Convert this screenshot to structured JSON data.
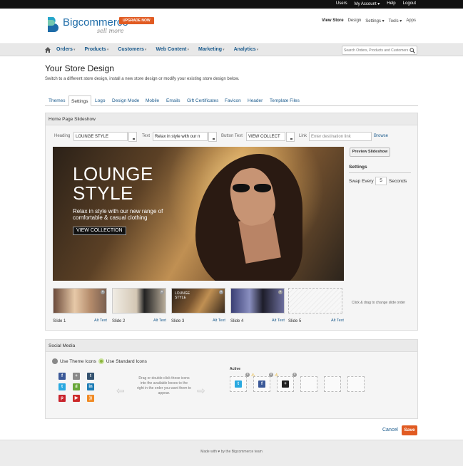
{
  "topbar": {
    "links": [
      "Users",
      "My Account ▾",
      "Help",
      "Logout"
    ]
  },
  "brand": {
    "name": "Bigcommerce",
    "tagline": "sell more",
    "upgrade": "UPGRADE NOW"
  },
  "util_nav": {
    "view_store": "View Store",
    "design": "Design",
    "settings": "Settings ▾",
    "tools": "Tools ▾",
    "apps": "Apps"
  },
  "main_nav": {
    "items": [
      "Orders",
      "Products",
      "Customers",
      "Web Content",
      "Marketing",
      "Analytics"
    ],
    "search_placeholder": "Search Orders, Products and Customers"
  },
  "page": {
    "title": "Your Store Design",
    "subtitle": "Switch to a different store design, install a new store design or modify your existing store design below."
  },
  "tabs": [
    "Themes",
    "Settings",
    "Logo",
    "Design Mode",
    "Mobile",
    "Emails",
    "Gift Certificates",
    "Favicon",
    "Header",
    "Template Files"
  ],
  "active_tab": "Settings",
  "slideshow": {
    "header": "Home Page Slideshow",
    "heading_label": "Heading",
    "heading_value": "LOUNGE STYLE",
    "text_label": "Text",
    "text_value": "Relax in style with our n",
    "button_label": "Button Text",
    "button_value": "VIEW COLLECT",
    "link_label": "Link",
    "link_placeholder": "Enter destination link",
    "browse": "Browse",
    "hero_title_line1": "LOUNGE",
    "hero_title_line2": "STYLE",
    "hero_text": "Relax in style with our new range of comfortable & casual clothing",
    "hero_button": "VIEW COLLECTION",
    "preview_button": "Preview Slideshow",
    "settings_label": "Settings",
    "swap_label": "Swap Every",
    "swap_value": "5",
    "seconds_label": "Seconds",
    "slides": [
      {
        "label": "Slide 1",
        "alt": "Alt Text"
      },
      {
        "label": "Slide 2",
        "alt": "Alt Text"
      },
      {
        "label": "Slide 3",
        "alt": "Alt Text"
      },
      {
        "label": "Slide 4",
        "alt": "Alt Text"
      },
      {
        "label": "Slide 5",
        "alt": "Alt Text"
      }
    ],
    "thumb3_title": "LOUNGE STYLE",
    "drag_hint": "Click & drag to change slide order"
  },
  "social": {
    "header": "Social Media",
    "option_theme": "Use Theme Icons",
    "option_standard": "Use Standard Icons",
    "drag_text": "Drag or double-click these icons into the available boxes to the right in the order you want them to appear.",
    "active_label": "Active",
    "icon_colors": {
      "facebook": "#3b5998",
      "googleplus": "#8a8a8a",
      "tumblr": "#34526f",
      "twitter": "#2aa9e0",
      "analytics": "#6aa83a",
      "linkedin": "#1c7cb5",
      "pinterest": "#c8232c",
      "youtube": "#cc2a2a",
      "rss": "#f08a24"
    }
  },
  "actions": {
    "cancel": "Cancel",
    "save": "Save"
  },
  "footer": {
    "text": "Made with ♥ by the Bigcommerce team"
  }
}
